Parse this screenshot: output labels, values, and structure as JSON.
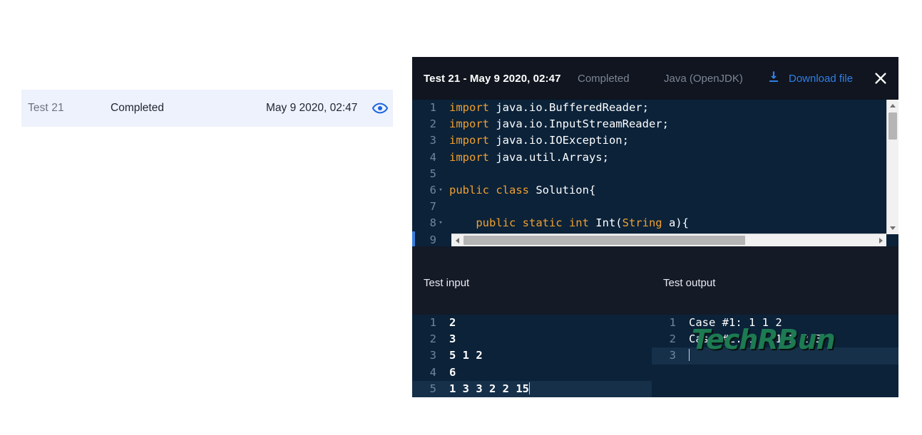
{
  "summary_row": {
    "name": "Test 21",
    "status": "Completed",
    "date": "May 9 2020, 02:47",
    "view_icon": "eye-icon"
  },
  "modal": {
    "header": {
      "title": "Test 21 - May 9 2020, 02:47",
      "status": "Completed",
      "language": "Java (OpenJDK)",
      "download_label": "Download file",
      "download_icon": "download-icon",
      "close_icon": "close-icon"
    },
    "editor": {
      "lines": [
        {
          "num": "1",
          "fold": false,
          "tokens": [
            {
              "t": "import",
              "c": "kw"
            },
            {
              "t": " java.io.BufferedReader;",
              "c": "pl"
            }
          ]
        },
        {
          "num": "2",
          "fold": false,
          "tokens": [
            {
              "t": "import",
              "c": "kw"
            },
            {
              "t": " java.io.InputStreamReader;",
              "c": "pl"
            }
          ]
        },
        {
          "num": "3",
          "fold": false,
          "tokens": [
            {
              "t": "import",
              "c": "kw"
            },
            {
              "t": " java.io.IOException;",
              "c": "pl"
            }
          ]
        },
        {
          "num": "4",
          "fold": false,
          "tokens": [
            {
              "t": "import",
              "c": "kw"
            },
            {
              "t": " java.util.Arrays;",
              "c": "pl"
            }
          ]
        },
        {
          "num": "5",
          "fold": false,
          "tokens": []
        },
        {
          "num": "6",
          "fold": true,
          "tokens": [
            {
              "t": "public class",
              "c": "kw"
            },
            {
              "t": " Solution{",
              "c": "pl"
            }
          ]
        },
        {
          "num": "7",
          "fold": false,
          "tokens": []
        },
        {
          "num": "8",
          "fold": true,
          "tokens": [
            {
              "t": "    public static int",
              "c": "kw"
            },
            {
              "t": " Int(",
              "c": "pl"
            },
            {
              "t": "String",
              "c": "kw"
            },
            {
              "t": " a){",
              "c": "pl"
            }
          ]
        },
        {
          "num": "9",
          "fold": false,
          "tokens": []
        }
      ],
      "scrollbar": {
        "up_arrow": "scroll-up-arrow",
        "down_arrow": "scroll-down-arrow",
        "left_arrow": "scroll-left-arrow",
        "right_arrow": "scroll-right-arrow"
      }
    },
    "test_input": {
      "label": "Test input",
      "lines": [
        {
          "num": "1",
          "text": "2",
          "active": false
        },
        {
          "num": "2",
          "text": "3",
          "active": false
        },
        {
          "num": "3",
          "text": "5 1 2",
          "active": false
        },
        {
          "num": "4",
          "text": "6",
          "active": false
        },
        {
          "num": "5",
          "text": "1 3 3 2 2 15",
          "active": true
        }
      ]
    },
    "test_output": {
      "label": "Test output",
      "lines": [
        {
          "num": "1",
          "text": "Case #1: 1 1 2",
          "active": false
        },
        {
          "num": "2",
          "text": "Case #2: 1 1 1 2 2 3",
          "active": false
        },
        {
          "num": "3",
          "text": "",
          "active": true
        }
      ],
      "watermark": "TechRBun"
    }
  },
  "colors": {
    "accent_blue": "#2f7fe8",
    "editor_bg": "#0b2239",
    "modal_bg": "#141a26",
    "header_bg": "#10151f",
    "keyword": "#f0a030",
    "row_highlight": "#eef2fc",
    "watermark_green": "#1d7a52"
  }
}
